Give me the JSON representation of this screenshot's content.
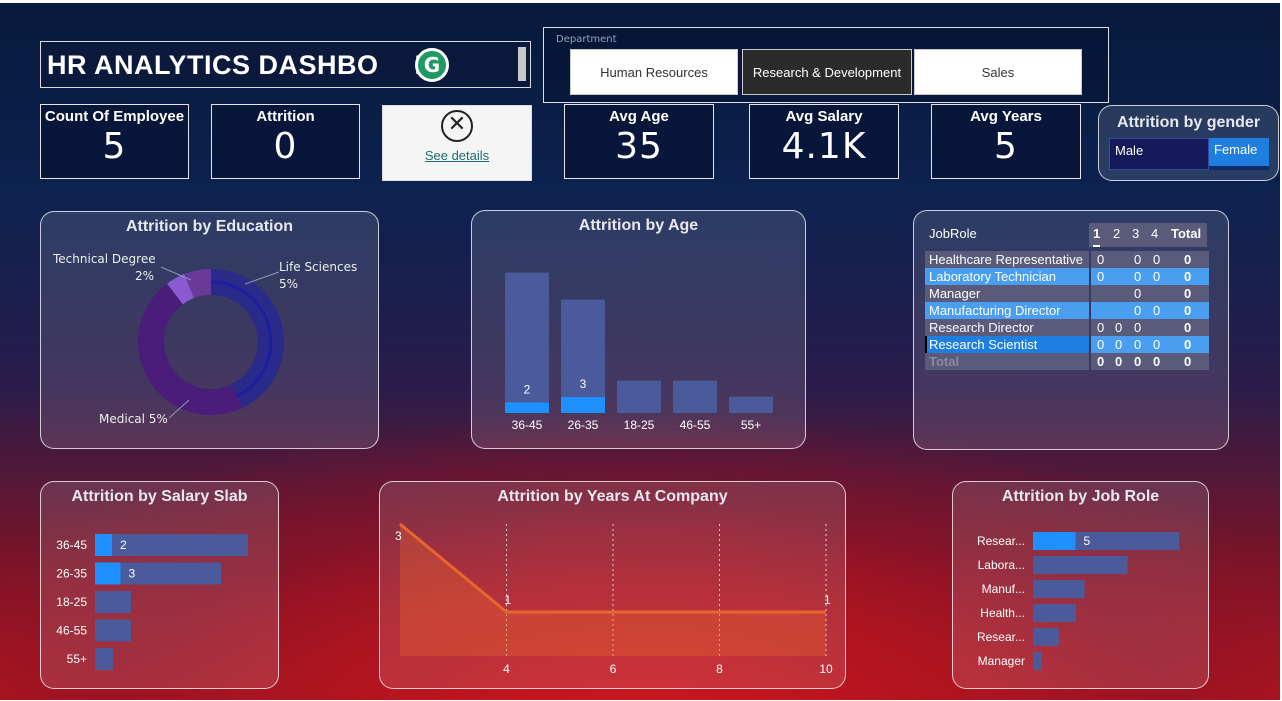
{
  "dashboard": {
    "title": "HR ANALYTICS DASHBOARD",
    "title_visible": "HR ANALYTICS DASHBO",
    "title_tail": "D",
    "badge": "G"
  },
  "department_slicer": {
    "label": "Department",
    "options": [
      "Human Resources",
      "Research & Development",
      "Sales"
    ],
    "selected": "Research & Development"
  },
  "kpis": {
    "count_employee": {
      "label": "Count Of Employee",
      "value": "5"
    },
    "attrition": {
      "label": "Attrition",
      "value": "0"
    },
    "avg_age": {
      "label": "Avg Age",
      "value": "35"
    },
    "avg_salary": {
      "label": "Avg Salary",
      "value": "4.1K"
    },
    "avg_years": {
      "label": "Avg Years",
      "value": "5"
    }
  },
  "details_card": {
    "icon": "close-circle-icon",
    "link": "See details"
  },
  "gender_slicer": {
    "title": "Attrition by gender",
    "options": [
      "Male",
      "Female"
    ],
    "selected": "Female"
  },
  "education": {
    "title": "Attrition by Education",
    "labels": {
      "technical": "Technical Degree",
      "technical_pct": "2%",
      "life": "Life Sciences",
      "life_pct": "5%",
      "medical": "Medical 5%"
    }
  },
  "matrix": {
    "header": {
      "row_label": "JobRole",
      "cols": [
        "1",
        "2",
        "3",
        "4",
        "Total"
      ]
    },
    "rows": [
      {
        "label": "Healthcare Representative",
        "c1": "0",
        "c2": "",
        "c3": "0",
        "c4": "0",
        "total": "0"
      },
      {
        "label": "Laboratory Technician",
        "c1": "0",
        "c2": "",
        "c3": "0",
        "c4": "0",
        "total": "0"
      },
      {
        "label": "Manager",
        "c1": "",
        "c2": "",
        "c3": "0",
        "c4": "",
        "total": "0"
      },
      {
        "label": "Manufacturing Director",
        "c1": "",
        "c2": "",
        "c3": "0",
        "c4": "0",
        "total": "0"
      },
      {
        "label": "Research Director",
        "c1": "0",
        "c2": "0",
        "c3": "0",
        "c4": "",
        "total": "0"
      },
      {
        "label": "Research Scientist",
        "c1": "0",
        "c2": "0",
        "c3": "0",
        "c4": "0",
        "total": "0"
      }
    ],
    "total_row": {
      "label": "Total",
      "c1": "0",
      "c2": "0",
      "c3": "0",
      "c4": "0",
      "total": "0"
    }
  },
  "colors": {
    "highlight": "#1e90ff",
    "bar_bg": "#4a5a9a",
    "line": "#e8662e",
    "donut_purple": "#4a1d7a",
    "donut_navy": "#2a2a8a"
  },
  "chart_data": [
    {
      "type": "bar",
      "title": "Attrition by Age",
      "categories": [
        "36-45",
        "26-35",
        "18-25",
        "46-55",
        "55+"
      ],
      "series": [
        {
          "values": [
            2,
            3,
            0,
            0,
            0
          ]
        },
        {
          "values": [
            26,
            21,
            6,
            6,
            3
          ]
        }
      ],
      "data_labels": [
        "2",
        "3",
        "",
        "",
        ""
      ]
    },
    {
      "type": "bar",
      "orientation": "horizontal",
      "title": "Attrition by Salary Slab",
      "categories": [
        "36-45",
        "26-35",
        "18-25",
        "46-55",
        "55+"
      ],
      "series": [
        {
          "values": [
            2,
            3,
            0,
            0,
            0
          ]
        },
        {
          "values": [
            17,
            14,
            4,
            4,
            2
          ]
        }
      ],
      "data_labels": [
        "2",
        "3",
        "",
        "",
        ""
      ]
    },
    {
      "type": "area",
      "title": "Attrition by Years At Company",
      "x": [
        2,
        4,
        10
      ],
      "y": [
        3,
        1,
        1
      ],
      "data_labels": [
        "3",
        "1",
        "1"
      ],
      "xticks": [
        "4",
        "6",
        "8",
        "10"
      ],
      "xlim": [
        2,
        10
      ],
      "ylim": [
        0,
        3
      ]
    },
    {
      "type": "bar",
      "orientation": "horizontal",
      "title": "Attrition by Job Role",
      "categories": [
        "Resear...",
        "Labora...",
        "Manuf...",
        "Health...",
        "Resear...",
        "Manager"
      ],
      "series": [
        {
          "values": [
            5,
            0,
            0,
            0,
            0,
            0
          ]
        },
        {
          "values": [
            17,
            11,
            6,
            5,
            3,
            1
          ]
        }
      ],
      "data_labels": [
        "5",
        "",
        "",
        "",
        "",
        ""
      ]
    },
    {
      "type": "pie",
      "title": "Attrition by Education",
      "categories": [
        "Life Sciences",
        "Medical",
        "Technical Degree"
      ],
      "values": [
        5,
        5,
        2
      ],
      "data_labels": [
        "Life Sciences 5%",
        "Medical 5%",
        "Technical Degree 2%"
      ]
    }
  ]
}
